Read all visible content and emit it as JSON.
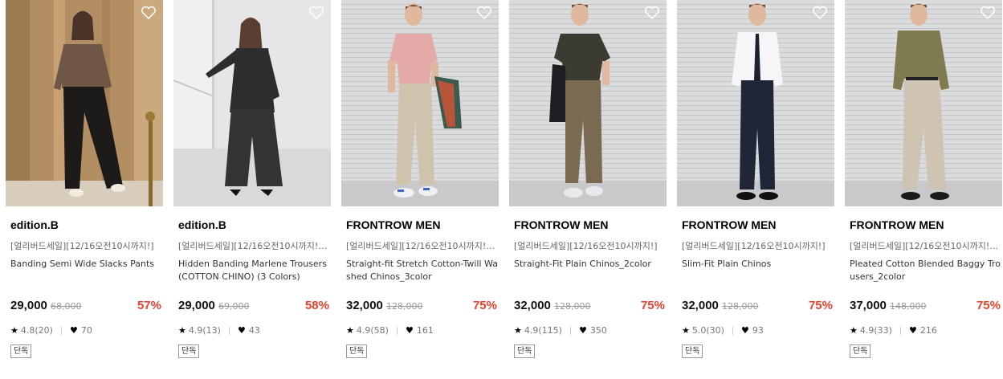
{
  "products": [
    {
      "brand": "edition.B",
      "promo": "[얼리버드세일][12/16오전10시까지!]",
      "name": "Banding Semi Wide Slacks Pants",
      "price": "29,000",
      "original_price": "68,000",
      "discount": "57%",
      "rating": "4.8(20)",
      "likes": "70",
      "badge": "단독"
    },
    {
      "brand": "edition.B",
      "promo": "[얼리버드세일][12/16오전10시까지!] ...",
      "name": "Hidden Banding Marlene Trousers (COTTON CHINO) (3 Colors)",
      "price": "29,000",
      "original_price": "69,000",
      "discount": "58%",
      "rating": "4.9(13)",
      "likes": "43",
      "badge": "단독"
    },
    {
      "brand": "FRONTROW MEN",
      "promo": "[얼리버드세일][12/16오전10시까지!] ...",
      "name": "Straight-fit Stretch Cotton-Twill Washed Chinos_3color",
      "price": "32,000",
      "original_price": "128,000",
      "discount": "75%",
      "rating": "4.9(58)",
      "likes": "161",
      "badge": "단독"
    },
    {
      "brand": "FRONTROW MEN",
      "promo": "[얼리버드세일][12/16오전10시까지!]",
      "name": "Straight-Fit Plain Chinos_2color",
      "price": "32,000",
      "original_price": "128,000",
      "discount": "75%",
      "rating": "4.9(115)",
      "likes": "350",
      "badge": "단독"
    },
    {
      "brand": "FRONTROW MEN",
      "promo": "[얼리버드세일][12/16오전10시까지!]",
      "name": "Slim-Fit Plain Chinos",
      "price": "32,000",
      "original_price": "128,000",
      "discount": "75%",
      "rating": "5.0(30)",
      "likes": "93",
      "badge": "단독"
    },
    {
      "brand": "FRONTROW MEN",
      "promo": "[얼리버드세일][12/16오전10시까지!] ...",
      "name": "Pleated Cotton Blended Baggy Trousers_2color",
      "price": "37,000",
      "original_price": "148,000",
      "discount": "75%",
      "rating": "4.9(33)",
      "likes": "216",
      "badge": "단독"
    }
  ],
  "colors": {
    "discount": "#e8412c"
  },
  "icons": {
    "wishlist": "heart-outline-icon",
    "rating": "star-icon",
    "likes": "heart-icon"
  }
}
